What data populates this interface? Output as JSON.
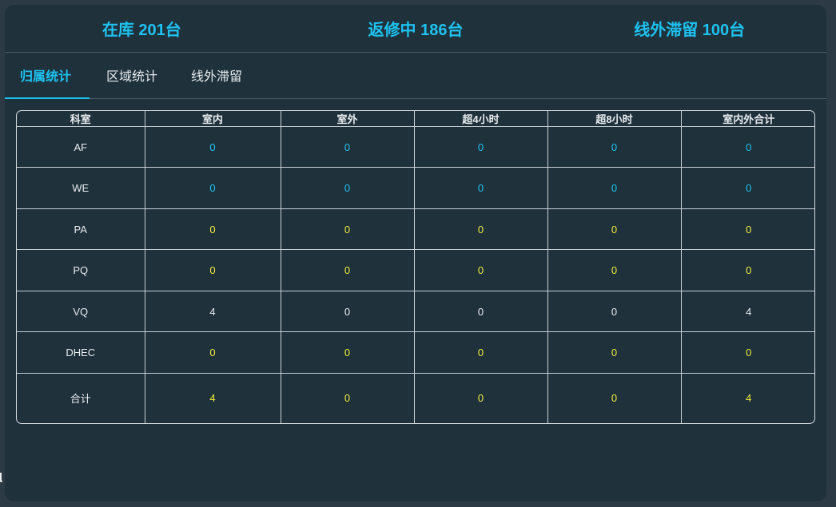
{
  "summary": {
    "in_stock": "在库 201台",
    "in_repair": "返修中 186台",
    "offline": "线外滞留 100台"
  },
  "tabs": [
    {
      "label": "归属统计",
      "active": true
    },
    {
      "label": "区域统计",
      "active": false
    },
    {
      "label": "线外滞留",
      "active": false
    }
  ],
  "table": {
    "headers": [
      "科室",
      "室内",
      "室外",
      "超4小时",
      "超8小时",
      "室内外合计"
    ],
    "rows": [
      {
        "name": "AF",
        "values": [
          "0",
          "0",
          "0",
          "0",
          "0"
        ],
        "color": "blue"
      },
      {
        "name": "WE",
        "values": [
          "0",
          "0",
          "0",
          "0",
          "0"
        ],
        "color": "blue"
      },
      {
        "name": "PA",
        "values": [
          "0",
          "0",
          "0",
          "0",
          "0"
        ],
        "color": "yellow"
      },
      {
        "name": "PQ",
        "values": [
          "0",
          "0",
          "0",
          "0",
          "0"
        ],
        "color": "yellow"
      },
      {
        "name": "VQ",
        "values": [
          "4",
          "0",
          "0",
          "0",
          "4"
        ],
        "color": "white"
      },
      {
        "name": "DHEC",
        "values": [
          "0",
          "0",
          "0",
          "0",
          "0"
        ],
        "color": "yellow"
      },
      {
        "name": "合计",
        "values": [
          "4",
          "0",
          "0",
          "0",
          "4"
        ],
        "color": "yellow"
      }
    ]
  },
  "colors": {
    "accent": "#1ec2f0",
    "blue": "#1ec2f0",
    "yellow": "#f0ea3a",
    "white": "#e8ecef",
    "panel": "#1f323c",
    "background": "#2b3a44"
  }
}
